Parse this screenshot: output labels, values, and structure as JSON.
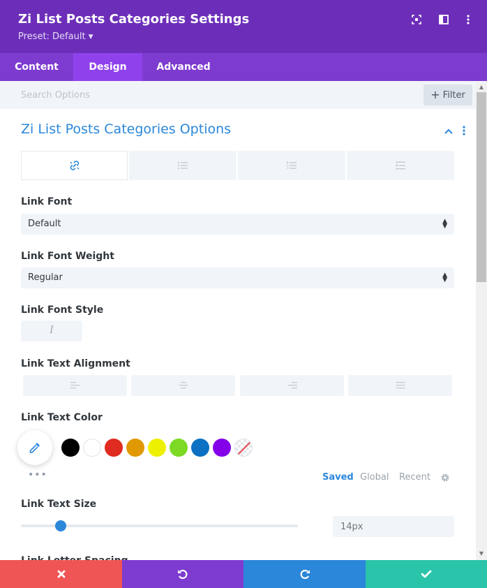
{
  "header": {
    "title": "Zi List Posts Categories Settings",
    "preset": "Preset: Default",
    "bg_color": "#6c2eb9",
    "icons": [
      "expand-icon",
      "split-view-icon",
      "more-vertical-icon"
    ]
  },
  "tabs": [
    {
      "label": "Content",
      "active": false
    },
    {
      "label": "Design",
      "active": true
    },
    {
      "label": "Advanced",
      "active": false
    }
  ],
  "search": {
    "placeholder": "Search Options",
    "filter_label": "Filter"
  },
  "section": {
    "title": "Zi List Posts Categories Options",
    "subtabs": [
      {
        "icon": "link-icon",
        "active": true
      },
      {
        "icon": "unordered-list-icon",
        "active": false
      },
      {
        "icon": "ordered-list-icon",
        "active": false
      },
      {
        "icon": "indent-icon",
        "active": false
      }
    ]
  },
  "fields": {
    "link_font": {
      "label": "Link Font",
      "value": "Default"
    },
    "link_font_weight": {
      "label": "Link Font Weight",
      "value": "Regular"
    },
    "link_font_style": {
      "label": "Link Font Style",
      "button": "I"
    },
    "link_text_alignment": {
      "label": "Link Text Alignment",
      "options": [
        "left",
        "center",
        "right",
        "justify"
      ]
    },
    "link_text_color": {
      "label": "Link Text Color",
      "swatches": [
        "#000000",
        "#ffffff",
        "#e02b20",
        "#e09900",
        "#edf000",
        "#7cda24",
        "#0c71c3",
        "#8300e9",
        "none"
      ],
      "palette_tabs": [
        "Saved",
        "Global",
        "Recent"
      ],
      "active_palette": "Saved"
    },
    "link_text_size": {
      "label": "Link Text Size",
      "placeholder": "14px",
      "slider_fraction": 0.14
    },
    "link_letter_spacing": {
      "label": "Link Letter Spacing"
    }
  },
  "footer": {
    "buttons": [
      {
        "name": "cancel",
        "color": "#ef5555"
      },
      {
        "name": "undo",
        "color": "#7e3bd0"
      },
      {
        "name": "redo",
        "color": "#2b87da"
      },
      {
        "name": "save",
        "color": "#29c4a9"
      }
    ]
  },
  "colors": {
    "accent": "#2b87da",
    "tab_bar": "#7e3bd0",
    "active_tab": "#8f42ec"
  }
}
